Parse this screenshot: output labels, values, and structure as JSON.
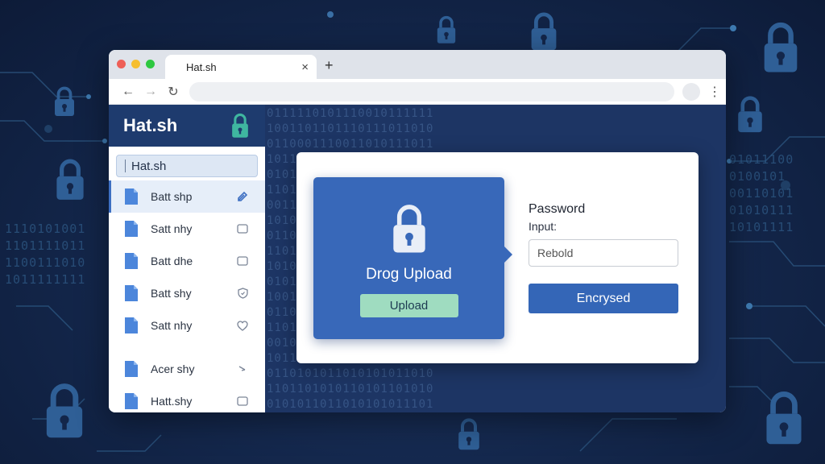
{
  "background": {
    "binary_left": "1110101001\n1101111011\n1100111010\n1011111111",
    "binary_right": "01011100\n0100101\n00110101\n01010111\n10101111",
    "colors": {
      "bg": "#13264a",
      "lock": "#2f5f96"
    }
  },
  "browser": {
    "tab_title": "Hat.sh",
    "tab_close_glyph": "×",
    "new_tab_glyph": "+",
    "back_glyph": "←",
    "forward_glyph": "→",
    "reload_glyph": "↻",
    "menu_glyph": "⋮"
  },
  "sidebar": {
    "title": "Hat.sh",
    "search_value": "Hat.sh",
    "header_color": "#1e3b6e",
    "items": [
      {
        "label": "Batt shp",
        "icon": "file-icon",
        "action_icon": "edit-icon"
      },
      {
        "label": "Satt nhy",
        "icon": "file-icon",
        "action_icon": "checkbox-icon"
      },
      {
        "label": "Batt dhe",
        "icon": "file-icon",
        "action_icon": "checkbox-icon"
      },
      {
        "label": "Batt shy",
        "icon": "file-icon",
        "action_icon": "shield-icon"
      },
      {
        "label": "Satt nhy",
        "icon": "file-icon",
        "action_icon": "heart-icon"
      },
      {
        "label": "Acer shy",
        "icon": "file-icon",
        "action_icon": "arrow-icon"
      },
      {
        "label": "Hatt.shy",
        "icon": "file-icon",
        "action_icon": "checkbox-icon"
      }
    ]
  },
  "main": {
    "binary": "0111110101110010111111\n1001101101110111011010\n0110001110011010111011\n1011111010110101011101\n0101101101011011010110\n1101011110110010110101\n0011010111101101011010\n1010110101101010110101\n0110101101110100101011\n1101010110100101011101\n1010110101111011011010\n0101101011010101101011\n1001010110101101010101\n0110101101011010101010\n1101011010110101101101\n0010110101111010101101\n1011010110101010110110\n0110101011010101011010\n1101101010110101101010\n0101011011010101011101\n1010101101011010101010\n0111110101110010111111",
    "drop_label": "Drog Upload",
    "upload_button": "Upload",
    "password_label": "Password",
    "password_sub_label": "Input:",
    "password_value": "Rebold",
    "encrypt_button": "Encrysed",
    "accent_color": "#3466b7",
    "upload_color": "#9fdcc0"
  }
}
